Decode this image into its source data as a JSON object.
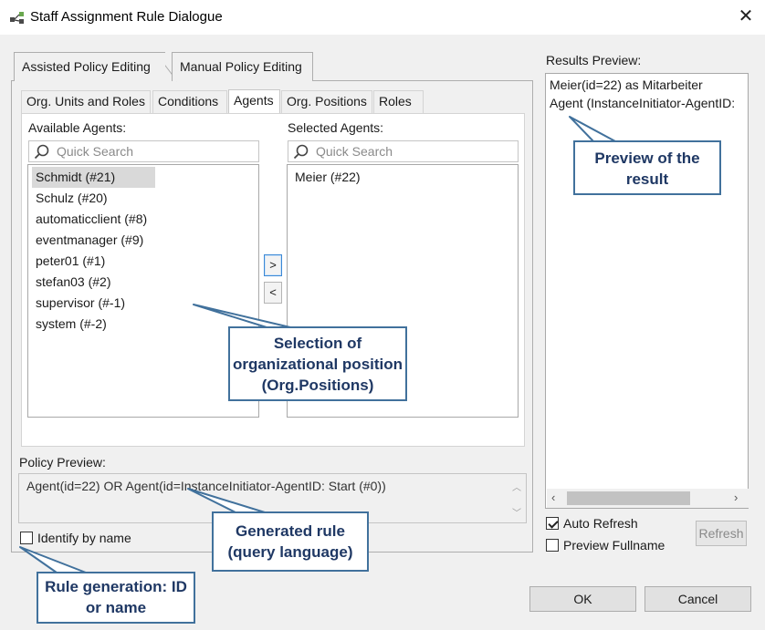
{
  "window": {
    "title": "Staff Assignment Rule Dialogue"
  },
  "main_tabs": [
    {
      "label": "Assisted Policy Editing",
      "active": true
    },
    {
      "label": "Manual Policy Editing",
      "active": false
    }
  ],
  "sub_tabs": [
    {
      "label": "Org. Units and Roles",
      "active": false
    },
    {
      "label": "Conditions",
      "active": false
    },
    {
      "label": "Agents",
      "active": true
    },
    {
      "label": "Org. Positions",
      "active": false
    },
    {
      "label": "Roles",
      "active": false
    }
  ],
  "available": {
    "label": "Available Agents:",
    "search_placeholder": "Quick Search",
    "items": [
      "Schmidt (#21)",
      "Schulz (#20)",
      "automaticclient (#8)",
      "eventmanager (#9)",
      "peter01 (#1)",
      "stefan03 (#2)",
      "supervisor (#-1)",
      "system (#-2)"
    ],
    "selected_index": 0
  },
  "selected": {
    "label": "Selected Agents:",
    "search_placeholder": "Quick Search",
    "items": [
      "Meier (#22)"
    ]
  },
  "move_buttons": {
    "add": ">",
    "remove": "<"
  },
  "policy_preview": {
    "label": "Policy Preview:",
    "text": "Agent(id=22) OR Agent(id=InstanceInitiator-AgentID: Start (#0))"
  },
  "identify_by_name": {
    "label": "Identify by name",
    "checked": false
  },
  "results_preview": {
    "label": "Results Preview:",
    "lines": [
      "Meier(id=22) as Mitarbeiter",
      "Agent (InstanceInitiator-AgentID:"
    ]
  },
  "auto_refresh": {
    "label": "Auto Refresh",
    "checked": true
  },
  "preview_fullname": {
    "label": "Preview Fullname",
    "checked": false
  },
  "buttons": {
    "refresh": "Refresh",
    "ok": "OK",
    "cancel": "Cancel"
  },
  "callouts": {
    "preview": "Preview of the result",
    "selection": "Selection of organizational position (Org.Positions)",
    "generated": "Generated rule (query language)",
    "rule_generation": "Rule generation: ID or name"
  },
  "colors": {
    "callout_border": "#41719c",
    "callout_text": "#1f3864",
    "list_selection": "#d9d9d9"
  }
}
